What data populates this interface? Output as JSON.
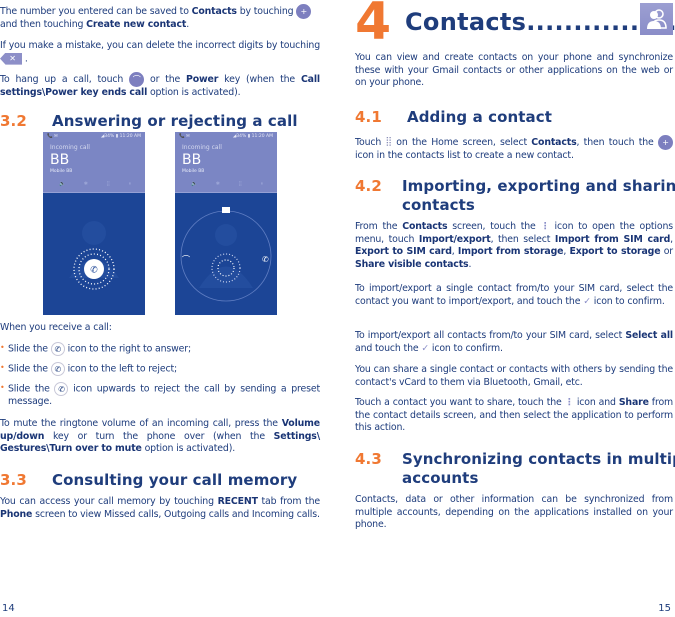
{
  "left_page": {
    "para1": {
      "t1": "The number you entered can be saved to ",
      "b1": "Contacts",
      "t2": " by touching ",
      "t3": " and then touching ",
      "b2": "Create new contact",
      "t4": "."
    },
    "para2": {
      "t1": "If you make a mistake, you can delete the incorrect digits by touching ",
      "t2": " ."
    },
    "para3": {
      "t1": "To hang up a call, touch ",
      "t2": " or the ",
      "b1": "Power",
      "t3": " key (when the ",
      "b2": "Call settings\\Power key ends call",
      "t4": " option is activated)."
    },
    "section_3_2": {
      "number": "3.2",
      "title": "Answering or rejecting a call"
    },
    "phone_screens": [
      {
        "status_left": "📞 ✉",
        "status_right": "◢34% ▮ 11:20 AM",
        "incoming": "Incoming call",
        "name": "BB",
        "sub": "Mobile BB",
        "tools": [
          "🔈",
          "✱",
          "⣿",
          "⏸"
        ]
      },
      {
        "status_left": "📞 ✉",
        "status_right": "◢34% ▮ 11:20 AM",
        "incoming": "Incoming call",
        "name": "BB",
        "sub": "Mobile BB",
        "tools": [
          "🔈",
          "✱",
          "⣿",
          "⏸"
        ]
      }
    ],
    "when_receive": "When you receive a call:",
    "bullets": [
      {
        "t1": "Slide the ",
        "t2": " icon to the right to answer;"
      },
      {
        "t1": "Slide the ",
        "t2": " icon to the left to reject;"
      },
      {
        "t1": "Slide the ",
        "t2": " icon upwards to reject the call by sending a preset message."
      }
    ],
    "mute_para": {
      "t1": "To mute the ringtone volume of an incoming call, press the ",
      "b1": "Volume up/down",
      "t2": " key or turn the phone over (when the ",
      "b2": "Settings\\ Gestures\\Turn over to mute",
      "t3": " option is activated)."
    },
    "section_3_3": {
      "number": "3.3",
      "title": "Consulting your call memory"
    },
    "memory_para": {
      "t1": "You can access your call memory by touching ",
      "b1": "RECENT",
      "t2": " tab from the ",
      "b2": "Phone",
      "t3": " screen to view Missed calls, Outgoing calls and Incoming calls."
    },
    "page_number": "14"
  },
  "right_page": {
    "chapter": {
      "number": "4",
      "title": "Contacts..................",
      "icon": "contacts-icon"
    },
    "intro": "You can view and create contacts on your phone and synchronize these with your Gmail contacts or other applications on the web or on your phone.",
    "section_4_1": {
      "number": "4.1",
      "title": "Adding a contact"
    },
    "adding_para": {
      "t1": "Touch ",
      "t2": " on the Home screen, select ",
      "b1": "Contacts",
      "t3": ", then touch the ",
      "t4": " icon in the contacts list to create a new contact."
    },
    "section_4_2": {
      "number": "4.2",
      "title": "Importing, exporting and sharing contacts"
    },
    "import_para1": {
      "t1": "From the ",
      "b1": "Contacts",
      "t2": " screen, touch the ",
      "t3": " icon to open the options menu, touch ",
      "b2": "Import/export",
      "t4": ", then select ",
      "b3": "Import from SIM card",
      "t5": ", ",
      "b4": "Export to SIM card",
      "t6": ", ",
      "b5": "Import from storage",
      "t7": ", ",
      "b6": "Export to storage",
      "t8": " or ",
      "b7": "Share visible contacts",
      "t9": "."
    },
    "import_para2": {
      "t1": "To import/export a single contact from/to your SIM card, select the contact you want to import/export, and touch the ",
      "t2": " icon to confirm."
    },
    "import_para3": {
      "t1": "To import/export all contacts from/to your SIM card, select ",
      "b1": "Select all",
      "t2": " and touch the ",
      "t3": " icon to confirm."
    },
    "share_para1": "You can share a single contact or contacts with others by sending the contact's vCard to them via Bluetooth, Gmail, etc.",
    "share_para2": {
      "t1": "Touch a contact you want to share, touch the ",
      "t2": " icon and ",
      "b1": "Share",
      "t3": " from the contact details screen, and then select the application to perform this action."
    },
    "section_4_3": {
      "number": "4.3",
      "title": "Synchronizing contacts in multiple accounts"
    },
    "sync_para": "Contacts, data or other information can be synchronized from multiple accounts, depending on the applications installed on your phone.",
    "page_number": "15"
  },
  "icons": {
    "add_contact": "+👤",
    "delete": "✕",
    "hangup": "☎",
    "phone": "📞",
    "apps": "⣿",
    "menu": "⋮",
    "check": "✓"
  },
  "colors": {
    "accent_orange": "#f07832",
    "heading_blue": "#1f3d7c",
    "phone_top": "#7b86c4",
    "phone_bottom": "#1c4596"
  }
}
